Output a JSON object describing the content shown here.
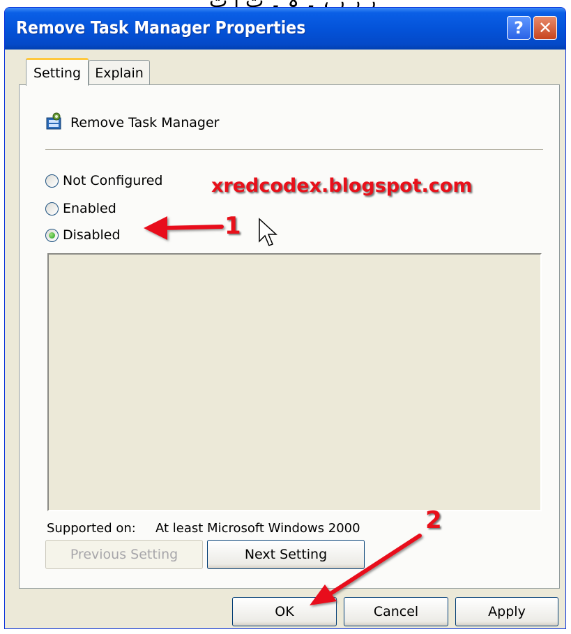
{
  "top_strip_text": "ر ر ر ، ۔ ہ ۔ ت ا ت",
  "window": {
    "title": "Remove Task Manager Properties",
    "help_glyph": "?",
    "close_glyph": "✕"
  },
  "tabs": [
    {
      "label": "Setting",
      "active": true
    },
    {
      "label": "Explain",
      "active": false
    }
  ],
  "policy": {
    "icon": "policy-icon",
    "name": "Remove Task Manager"
  },
  "options": [
    {
      "label": "Not Configured",
      "checked": false
    },
    {
      "label": "Enabled",
      "checked": false
    },
    {
      "label": "Disabled",
      "checked": true
    }
  ],
  "watermark": "xredcodex.blogspot.com",
  "annotations": {
    "step1": "1",
    "step2": "2",
    "arrow_color": "#e8101a"
  },
  "supported": {
    "label": "Supported on:",
    "value": "At least Microsoft Windows 2000"
  },
  "nav_buttons": {
    "previous": "Previous Setting",
    "next": "Next Setting"
  },
  "dialog_buttons": {
    "ok": "OK",
    "cancel": "Cancel",
    "apply": "Apply"
  }
}
